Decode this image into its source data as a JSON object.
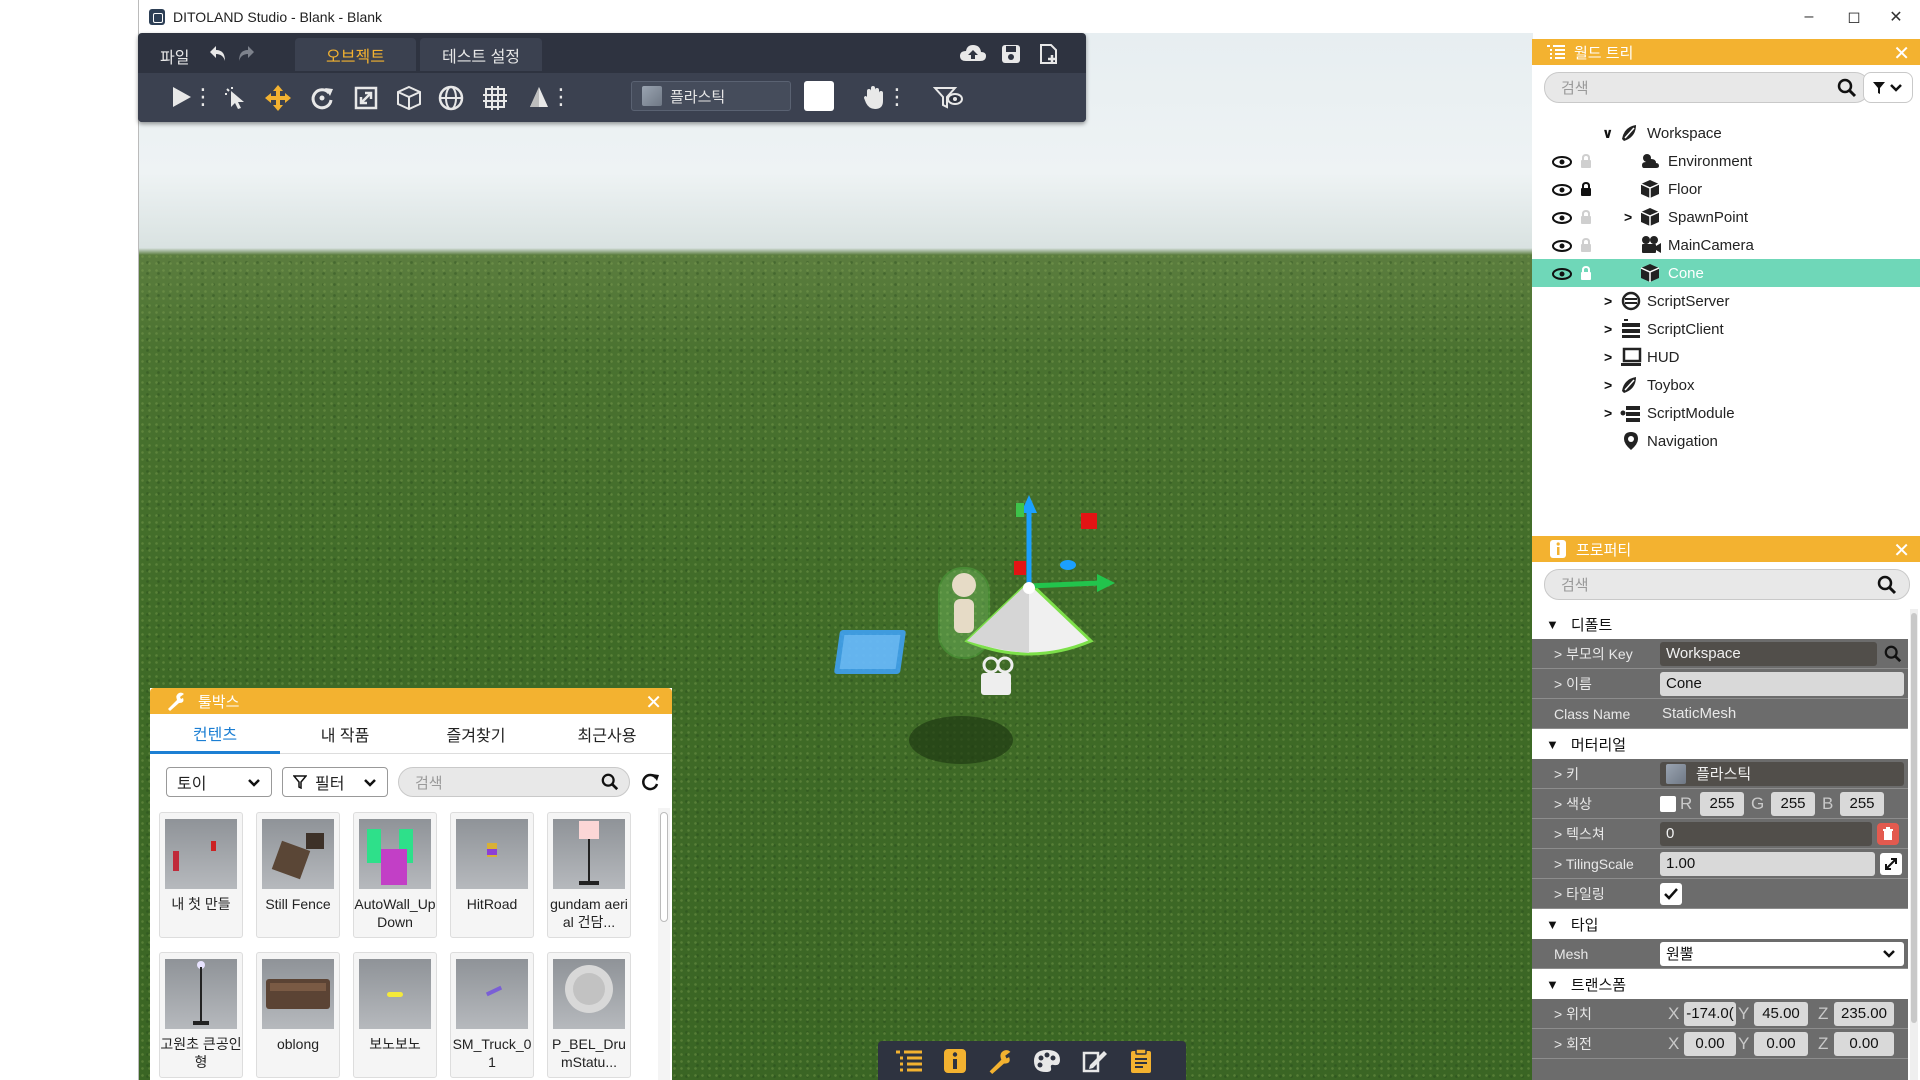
{
  "window": {
    "title": "DITOLAND Studio - Blank - Blank"
  },
  "toolbar": {
    "file_menu": "파일",
    "tabs": [
      {
        "label": "오브젝트",
        "active": true
      },
      {
        "label": "테스트 설정",
        "active": false
      }
    ],
    "material_label": "플라스틱"
  },
  "world_tree": {
    "title": "월드 트리",
    "search_placeholder": "검색",
    "items": [
      {
        "label": "Workspace",
        "icon": "workspace-icon",
        "expanded": true
      },
      {
        "label": "Environment",
        "icon": "environment-icon"
      },
      {
        "label": "Floor",
        "icon": "cube-icon",
        "locked": true
      },
      {
        "label": "SpawnPoint",
        "icon": "cube-icon",
        "collapsed": true
      },
      {
        "label": "MainCamera",
        "icon": "camera-icon"
      },
      {
        "label": "Cone",
        "icon": "cube-icon",
        "selected": true
      },
      {
        "label": "ScriptServer",
        "icon": "script-server-icon"
      },
      {
        "label": "ScriptClient",
        "icon": "script-client-icon"
      },
      {
        "label": "HUD",
        "icon": "hud-icon"
      },
      {
        "label": "Toybox",
        "icon": "toybox-icon"
      },
      {
        "label": "ScriptModule",
        "icon": "script-module-icon"
      },
      {
        "label": "Navigation",
        "icon": "location-pin-icon"
      }
    ]
  },
  "properties": {
    "title": "프로퍼티",
    "search_placeholder": "검색",
    "sections": {
      "default": "디폴트",
      "material": "머터리얼",
      "type": "타입",
      "transform": "트랜스폼"
    },
    "parent_key_label": "> 부모의 Key",
    "parent_key_value": "Workspace",
    "name_label": "> 이름",
    "name_value": "Cone",
    "class_label": "Class Name",
    "class_value": "StaticMesh",
    "key_label": "> 키",
    "key_value": "플라스틱",
    "color_label": "> 색상",
    "color_r": "255",
    "color_g": "255",
    "color_b": "255",
    "r_axis": "R",
    "g_axis": "G",
    "b_axis": "B",
    "texture_label": "> 텍스쳐",
    "texture_value": "0",
    "tiling_label": "> TilingScale",
    "tiling_value": "1.00",
    "tiled_label": "> 타일링",
    "mesh_label": "Mesh",
    "mesh_value": "원뿔",
    "position_label": "> 위치",
    "position": {
      "x": "-174.0(",
      "y": "45.00",
      "z": "235.00"
    },
    "rotation_label": "> 회전",
    "rotation": {
      "x": "0.00",
      "y": "0.00",
      "z": "0.00"
    },
    "x_axis": "X",
    "y_axis": "Y",
    "z_axis": "Z"
  },
  "toolbox": {
    "title": "툴박스",
    "tabs": [
      {
        "label": "컨텐츠",
        "active": true
      },
      {
        "label": "내 작품"
      },
      {
        "label": "즐겨찾기"
      },
      {
        "label": "최근사용"
      }
    ],
    "category": "토이",
    "filter": "필터",
    "search_placeholder": "검색",
    "items": [
      {
        "label": "내 첫 만들"
      },
      {
        "label": "Still Fence"
      },
      {
        "label": "AutoWall_UpDown"
      },
      {
        "label": "HitRoad"
      },
      {
        "label": "gundam aerial 건담..."
      },
      {
        "label": "고원초 큰공인형"
      },
      {
        "label": "oblong"
      },
      {
        "label": "보노보노"
      },
      {
        "label": "SM_Truck_01"
      },
      {
        "label": "P_BEL_DrumStatu..."
      }
    ]
  },
  "colors": {
    "accent": "#f3b230",
    "selected_row": "#6fd7b8",
    "toolbar_bg": "#2e3340",
    "tab_active_text": "#f3b230",
    "toolbox_tab_active": "#1c7fd3"
  }
}
